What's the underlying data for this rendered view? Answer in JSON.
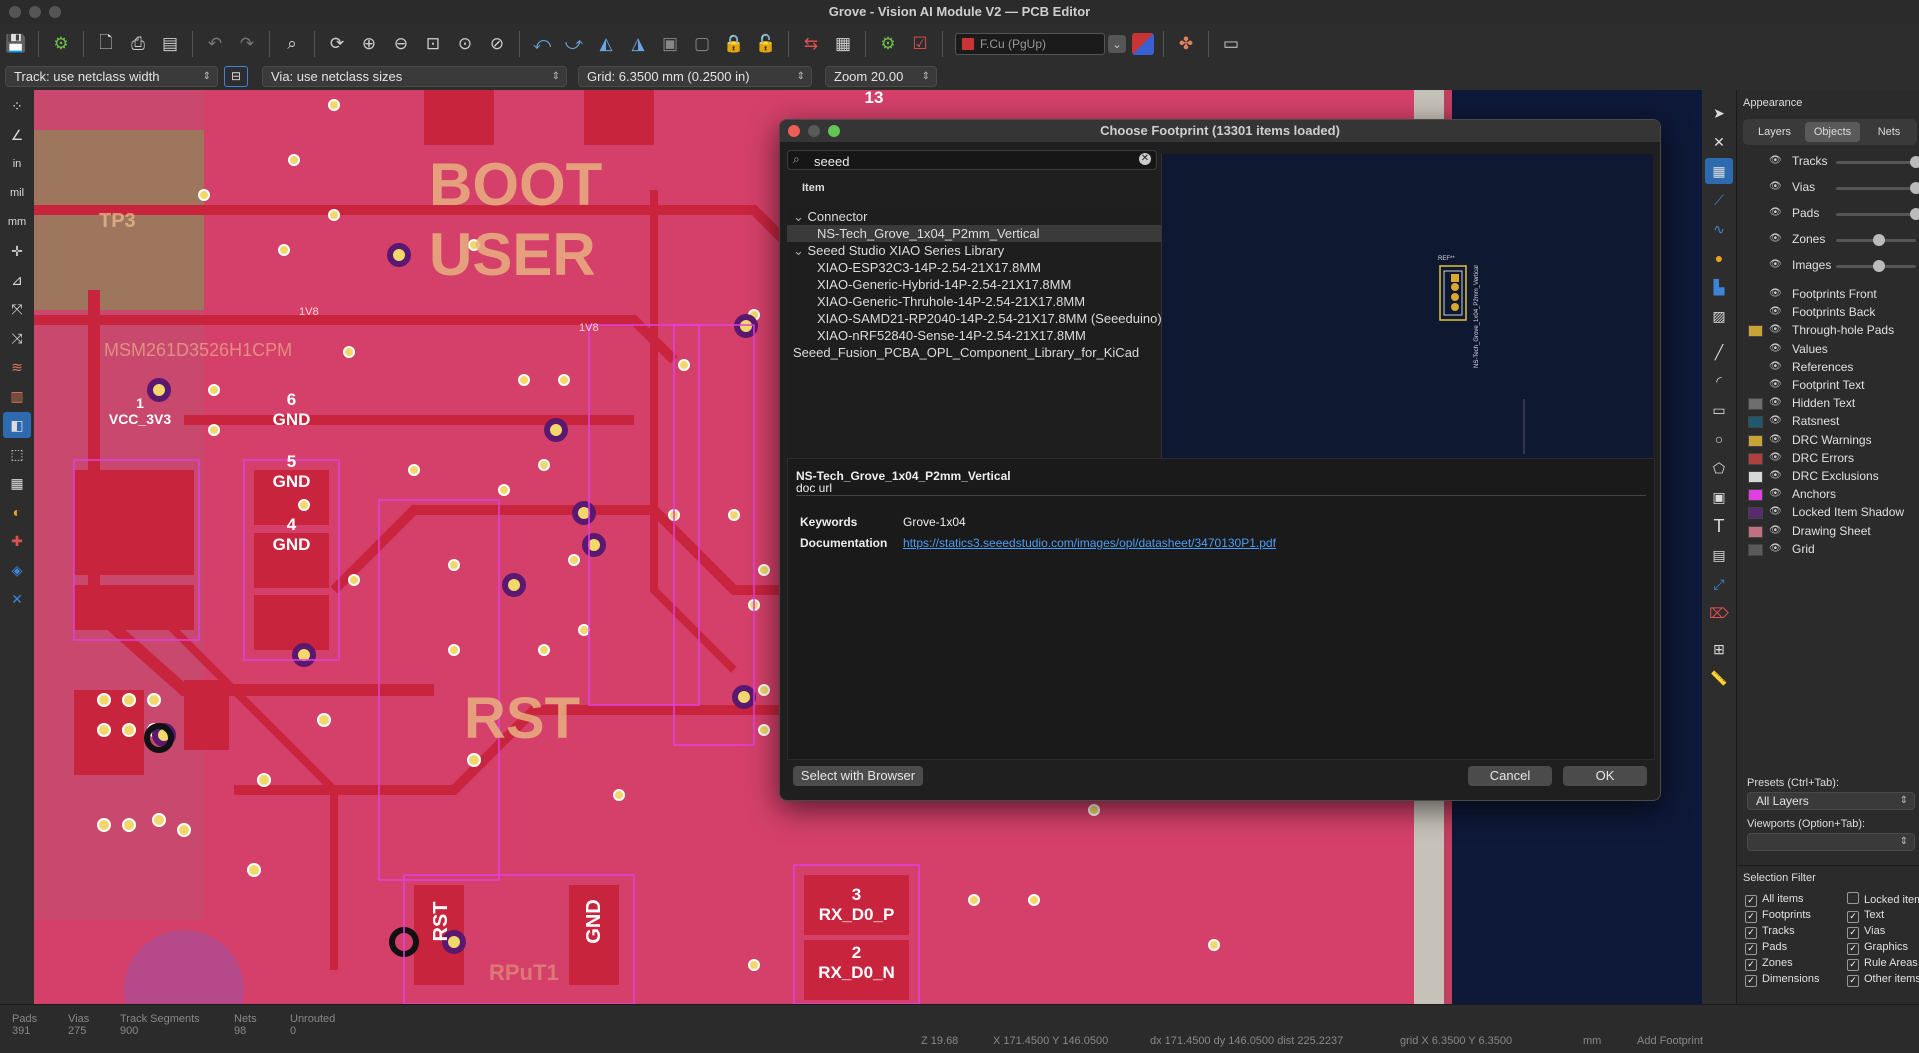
{
  "window": {
    "title": "Grove - Vision AI Module V2 — PCB Editor"
  },
  "toolbar": {
    "active_layer": "F.Cu (PgUp)",
    "layer_color": "#c83434"
  },
  "aux": {
    "track": "Track: use netclass width",
    "via": "Via: use netclass sizes",
    "grid": "Grid: 6.3500 mm (0.2500 in)",
    "zoom": "Zoom 20.00"
  },
  "lefttools": {
    "in_label": "in",
    "mil_label": "mil",
    "mm_label": "mm"
  },
  "pcb_labels": {
    "boot": "BOOT",
    "user": "USER",
    "rst": "RST",
    "v1": "1V8",
    "v2": "1V8",
    "tp3": "TP3",
    "msm": "MSM261D3526H1CPM",
    "pad_vcc": "VCC_3V3",
    "pad6": "GND",
    "pad5": "GND",
    "pad4": "GND",
    "num1": "1",
    "num2": "2",
    "num3": "3",
    "num4": "4",
    "num5": "5",
    "num6": "6",
    "rx_p": "RX_D0_P",
    "rx_n": "RX_D0_N",
    "gnd1": "GND",
    "rst_pad": "RST",
    "gnd_pad": "GND",
    "n13": "13",
    "rpush": "RPuT1"
  },
  "dialog": {
    "title": "Choose Footprint (13301 items loaded)",
    "search_value": "seeed",
    "column_header": "Item",
    "tree": [
      {
        "label": "Connector",
        "type": "group"
      },
      {
        "label": "NS-Tech_Grove_1x04_P2mm_Vertical",
        "type": "item",
        "selected": true
      },
      {
        "label": "Seeed Studio XIAO Series Library",
        "type": "group"
      },
      {
        "label": "XIAO-ESP32C3-14P-2.54-21X17.8MM",
        "type": "item"
      },
      {
        "label": "XIAO-Generic-Hybrid-14P-2.54-21X17.8MM",
        "type": "item"
      },
      {
        "label": "XIAO-Generic-Thruhole-14P-2.54-21X17.8MM",
        "type": "item"
      },
      {
        "label": "XIAO-SAMD21-RP2040-14P-2.54-21X17.8MM (Seeeduino)",
        "type": "item"
      },
      {
        "label": "XIAO-nRF52840-Sense-14P-2.54-21X17.8MM",
        "type": "item"
      },
      {
        "label": "Seeed_Fusion_PCBA_OPL_Component_Library_for_KiCad",
        "type": "group-collapsed"
      }
    ],
    "preview_ref": "REF**",
    "preview_value": "NS-Tech_Grove_1x04_P2mm_Vertical",
    "info_name": "NS-Tech_Grove_1x04_P2mm_Vertical",
    "info_desc": "doc url",
    "keywords_label": "Keywords",
    "keywords_value": "Grove-1x04",
    "doc_label": "Documentation",
    "doc_value": "https://statics3.seeedstudio.com/images/opl/datasheet/3470130P1.pdf",
    "btn_browser": "Select with Browser",
    "btn_cancel": "Cancel",
    "btn_ok": "OK"
  },
  "appearance": {
    "title": "Appearance",
    "tabs": [
      "Layers",
      "Objects",
      "Nets"
    ],
    "active_tab": "Objects",
    "slider_rows": [
      {
        "label": "Tracks",
        "knob": 1.0
      },
      {
        "label": "Vias",
        "knob": 1.0
      },
      {
        "label": "Pads",
        "knob": 1.0
      },
      {
        "label": "Zones",
        "knob": 0.5
      },
      {
        "label": "Images",
        "knob": 0.5
      }
    ],
    "rows": [
      {
        "label": "Footprints Front",
        "color": ""
      },
      {
        "label": "Footprints Back",
        "color": ""
      },
      {
        "label": "Through-hole Pads",
        "color": "#c8a436"
      },
      {
        "label": "Values",
        "color": ""
      },
      {
        "label": "References",
        "color": ""
      },
      {
        "label": "Footprint Text",
        "color": ""
      },
      {
        "label": "Hidden Text",
        "color": "#6e6e6e"
      },
      {
        "label": "Ratsnest",
        "color": "#1f5870"
      },
      {
        "label": "DRC Warnings",
        "color": "#c8a436"
      },
      {
        "label": "DRC Errors",
        "color": "#b04040"
      },
      {
        "label": "DRC Exclusions",
        "color": "#d8d8d8"
      },
      {
        "label": "Anchors",
        "color": "#e040e0"
      },
      {
        "label": "Locked Item Shadow",
        "color": "#5a2a6e"
      },
      {
        "label": "Drawing Sheet",
        "color": "#c07080"
      },
      {
        "label": "Grid",
        "color": "#5a5a5a"
      }
    ],
    "presets_label": "Presets (Ctrl+Tab):",
    "presets_value": "All Layers",
    "viewports_label": "Viewports (Option+Tab):",
    "viewports_value": "",
    "selection_filter_title": "Selection Filter",
    "filters_left": [
      "All items",
      "Footprints",
      "Tracks",
      "Pads",
      "Zones",
      "Dimensions"
    ],
    "filters_right": [
      "Locked items",
      "Text",
      "Vias",
      "Graphics",
      "Rule Areas",
      "Other items"
    ]
  },
  "status": {
    "pads_label": "Pads",
    "pads": "391",
    "vias_label": "Vias",
    "vias": "275",
    "segs_label": "Track Segments",
    "segs": "900",
    "nets_label": "Nets",
    "nets": "98",
    "unrouted_label": "Unrouted",
    "unrouted": "0",
    "z": "Z 19.68",
    "xy": "X 171.4500  Y 146.0500",
    "dxy": "dx 171.4500  dy 146.0500  dist 225.2237",
    "grid": "grid X 6.3500  Y 6.3500",
    "unit": "mm",
    "mode": "Add Footprint"
  }
}
